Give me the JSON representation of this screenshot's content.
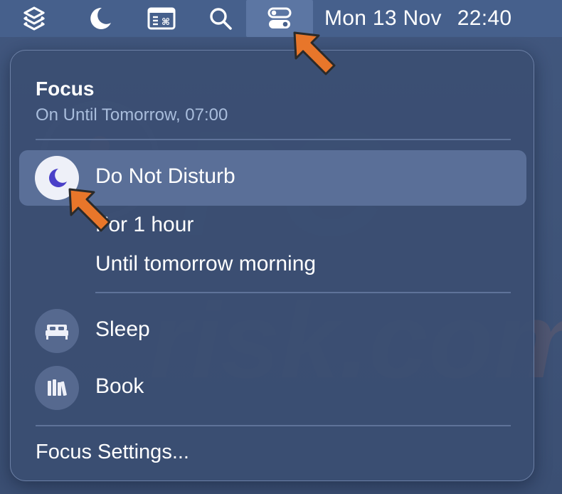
{
  "menubar": {
    "icons": [
      "stack-layers-icon",
      "moon-icon",
      "keyboard-window-icon",
      "search-icon",
      "control-center-icon"
    ],
    "date": "Mon 13 Nov",
    "time": "22:40"
  },
  "focus_panel": {
    "title": "Focus",
    "subtitle": "On Until Tomorrow, 07:00",
    "items": [
      {
        "label": "Do Not Disturb",
        "icon": "moon-icon",
        "active": true
      },
      {
        "label": "Sleep",
        "icon": "bed-icon",
        "active": false
      },
      {
        "label": "Book",
        "icon": "books-icon",
        "active": false
      }
    ],
    "dnd_options": [
      "For 1 hour",
      "Until tomorrow morning"
    ],
    "settings_label": "Focus Settings..."
  },
  "colors": {
    "menubar": "#46608c",
    "panel": "#3b4e72",
    "highlight_row": "#5a6f98",
    "accent_moon": "#4a40c8",
    "annotation_arrow": "#e8762a",
    "subtitle": "#a9bddc"
  },
  "watermark": {
    "text": "PCrisk.com"
  }
}
